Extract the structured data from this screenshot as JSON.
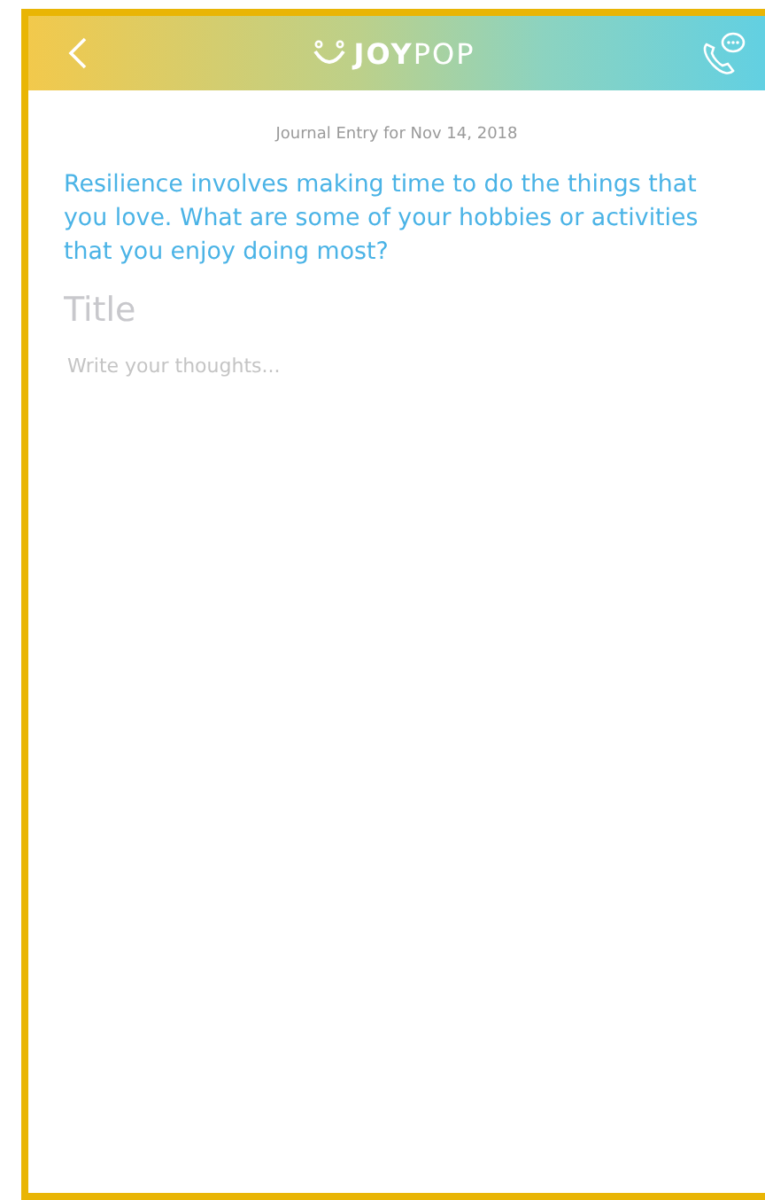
{
  "header": {
    "logo": "**JOY**POP"
  },
  "entry": {
    "date": "Journal Entry for Nov 14, 2018",
    "prompt": "Resilience involves making time to do the things that you love. What are some of your hobbies or activities that you enjoy doing most?",
    "title": {
      "placeholder": "Title"
    },
    "body": {
      "placeholder": "Write your thoughts..."
    }
  }
}
